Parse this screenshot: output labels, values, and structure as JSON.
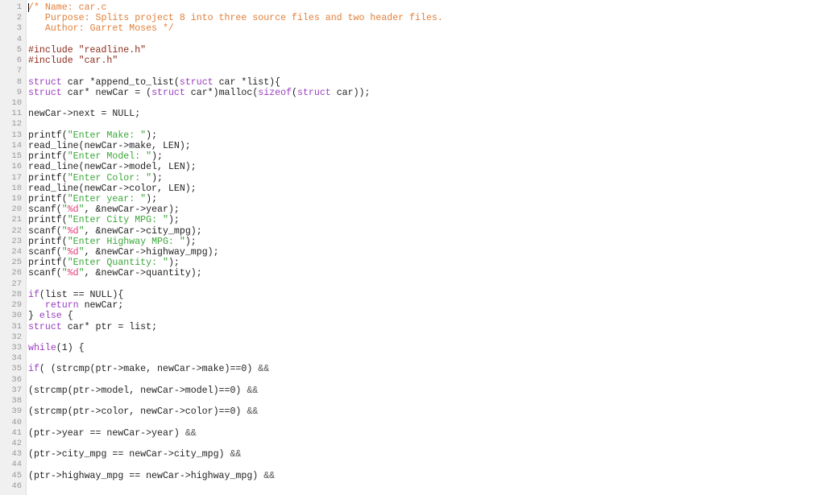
{
  "file": {
    "name": "car.c"
  },
  "cursor": {
    "line": 1,
    "column": 1
  },
  "colors": {
    "comment": "#e0803a",
    "keyword": "#9a3cc0",
    "string": "#3aa63a",
    "format_specifier": "#e0407a",
    "preprocessor": "#8b2a1a",
    "text": "#222222",
    "line_number": "#999999",
    "gutter_bg": "#f0f0f0"
  },
  "lines": [
    {
      "n": "1",
      "tokens": [
        [
          "comment",
          "/* Name: car.c"
        ]
      ]
    },
    {
      "n": "2",
      "tokens": [
        [
          "comment",
          "   Purpose: Splits project 8 into three source files and two header files."
        ]
      ]
    },
    {
      "n": "3",
      "tokens": [
        [
          "comment",
          "   Author: Garret Moses */"
        ]
      ]
    },
    {
      "n": "4",
      "tokens": []
    },
    {
      "n": "5",
      "tokens": [
        [
          "pre",
          "#include \"readline.h\""
        ]
      ]
    },
    {
      "n": "6",
      "tokens": [
        [
          "pre",
          "#include \"car.h\""
        ]
      ]
    },
    {
      "n": "7",
      "tokens": []
    },
    {
      "n": "8",
      "tokens": [
        [
          "kw",
          "struct"
        ],
        [
          "plain",
          " car *append_to_list("
        ],
        [
          "kw",
          "struct"
        ],
        [
          "plain",
          " car *list){"
        ]
      ]
    },
    {
      "n": "9",
      "tokens": [
        [
          "kw",
          "struct"
        ],
        [
          "plain",
          " car* newCar = ("
        ],
        [
          "kw",
          "struct"
        ],
        [
          "plain",
          " car*)malloc("
        ],
        [
          "kw",
          "sizeof"
        ],
        [
          "plain",
          "("
        ],
        [
          "kw",
          "struct"
        ],
        [
          "plain",
          " car));"
        ]
      ]
    },
    {
      "n": "10",
      "tokens": []
    },
    {
      "n": "11",
      "tokens": [
        [
          "plain",
          "newCar->next = NULL;"
        ]
      ]
    },
    {
      "n": "12",
      "tokens": []
    },
    {
      "n": "13",
      "tokens": [
        [
          "plain",
          "printf("
        ],
        [
          "str",
          "\"Enter Make: \""
        ],
        [
          "plain",
          ");"
        ]
      ]
    },
    {
      "n": "14",
      "tokens": [
        [
          "plain",
          "read_line(newCar->make, LEN);"
        ]
      ]
    },
    {
      "n": "15",
      "tokens": [
        [
          "plain",
          "printf("
        ],
        [
          "str",
          "\"Enter Model: \""
        ],
        [
          "plain",
          ");"
        ]
      ]
    },
    {
      "n": "16",
      "tokens": [
        [
          "plain",
          "read_line(newCar->model, LEN);"
        ]
      ]
    },
    {
      "n": "17",
      "tokens": [
        [
          "plain",
          "printf("
        ],
        [
          "str",
          "\"Enter Color: \""
        ],
        [
          "plain",
          ");"
        ]
      ]
    },
    {
      "n": "18",
      "tokens": [
        [
          "plain",
          "read_line(newCar->color, LEN);"
        ]
      ]
    },
    {
      "n": "19",
      "tokens": [
        [
          "plain",
          "printf("
        ],
        [
          "str",
          "\"Enter year: \""
        ],
        [
          "plain",
          ");"
        ]
      ]
    },
    {
      "n": "20",
      "tokens": [
        [
          "plain",
          "scanf("
        ],
        [
          "str",
          "\""
        ],
        [
          "fmt",
          "%d"
        ],
        [
          "str",
          "\""
        ],
        [
          "plain",
          ", &newCar->year);"
        ]
      ]
    },
    {
      "n": "21",
      "tokens": [
        [
          "plain",
          "printf("
        ],
        [
          "str",
          "\"Enter City MPG: \""
        ],
        [
          "plain",
          ");"
        ]
      ]
    },
    {
      "n": "22",
      "tokens": [
        [
          "plain",
          "scanf("
        ],
        [
          "str",
          "\""
        ],
        [
          "fmt",
          "%d"
        ],
        [
          "str",
          "\""
        ],
        [
          "plain",
          ", &newCar->city_mpg);"
        ]
      ]
    },
    {
      "n": "23",
      "tokens": [
        [
          "plain",
          "printf("
        ],
        [
          "str",
          "\"Enter Highway MPG: \""
        ],
        [
          "plain",
          ");"
        ]
      ]
    },
    {
      "n": "24",
      "tokens": [
        [
          "plain",
          "scanf("
        ],
        [
          "str",
          "\""
        ],
        [
          "fmt",
          "%d"
        ],
        [
          "str",
          "\""
        ],
        [
          "plain",
          ", &newCar->highway_mpg);"
        ]
      ]
    },
    {
      "n": "25",
      "tokens": [
        [
          "plain",
          "printf("
        ],
        [
          "str",
          "\"Enter Quantity: \""
        ],
        [
          "plain",
          ");"
        ]
      ]
    },
    {
      "n": "26",
      "tokens": [
        [
          "plain",
          "scanf("
        ],
        [
          "str",
          "\""
        ],
        [
          "fmt",
          "%d"
        ],
        [
          "str",
          "\""
        ],
        [
          "plain",
          ", &newCar->quantity);"
        ]
      ]
    },
    {
      "n": "27",
      "tokens": []
    },
    {
      "n": "28",
      "tokens": [
        [
          "kw",
          "if"
        ],
        [
          "plain",
          "(list == NULL){"
        ]
      ]
    },
    {
      "n": "29",
      "tokens": [
        [
          "plain",
          "   "
        ],
        [
          "kw",
          "return"
        ],
        [
          "plain",
          " newCar;"
        ]
      ]
    },
    {
      "n": "30",
      "tokens": [
        [
          "plain",
          "} "
        ],
        [
          "kw",
          "else"
        ],
        [
          "plain",
          " {"
        ]
      ]
    },
    {
      "n": "31",
      "tokens": [
        [
          "kw",
          "struct"
        ],
        [
          "plain",
          " car* ptr = list;"
        ]
      ]
    },
    {
      "n": "32",
      "tokens": []
    },
    {
      "n": "33",
      "tokens": [
        [
          "kw",
          "while"
        ],
        [
          "plain",
          "(1) {"
        ]
      ]
    },
    {
      "n": "34",
      "tokens": []
    },
    {
      "n": "35",
      "tokens": [
        [
          "kw",
          "if"
        ],
        [
          "plain",
          "( (strcmp(ptr->make, newCar->make)==0) "
        ],
        [
          "op",
          "&&"
        ]
      ]
    },
    {
      "n": "36",
      "tokens": []
    },
    {
      "n": "37",
      "tokens": [
        [
          "plain",
          "(strcmp(ptr->model, newCar->model)==0) "
        ],
        [
          "op",
          "&&"
        ]
      ]
    },
    {
      "n": "38",
      "tokens": []
    },
    {
      "n": "39",
      "tokens": [
        [
          "plain",
          "(strcmp(ptr->color, newCar->color)==0) "
        ],
        [
          "op",
          "&&"
        ]
      ]
    },
    {
      "n": "40",
      "tokens": []
    },
    {
      "n": "41",
      "tokens": [
        [
          "plain",
          "(ptr->year == newCar->year) "
        ],
        [
          "op",
          "&&"
        ]
      ]
    },
    {
      "n": "42",
      "tokens": []
    },
    {
      "n": "43",
      "tokens": [
        [
          "plain",
          "(ptr->city_mpg == newCar->city_mpg) "
        ],
        [
          "op",
          "&&"
        ]
      ]
    },
    {
      "n": "44",
      "tokens": []
    },
    {
      "n": "45",
      "tokens": [
        [
          "plain",
          "(ptr->highway_mpg == newCar->highway_mpg) "
        ],
        [
          "op",
          "&&"
        ]
      ]
    },
    {
      "n": "46",
      "tokens": []
    }
  ]
}
